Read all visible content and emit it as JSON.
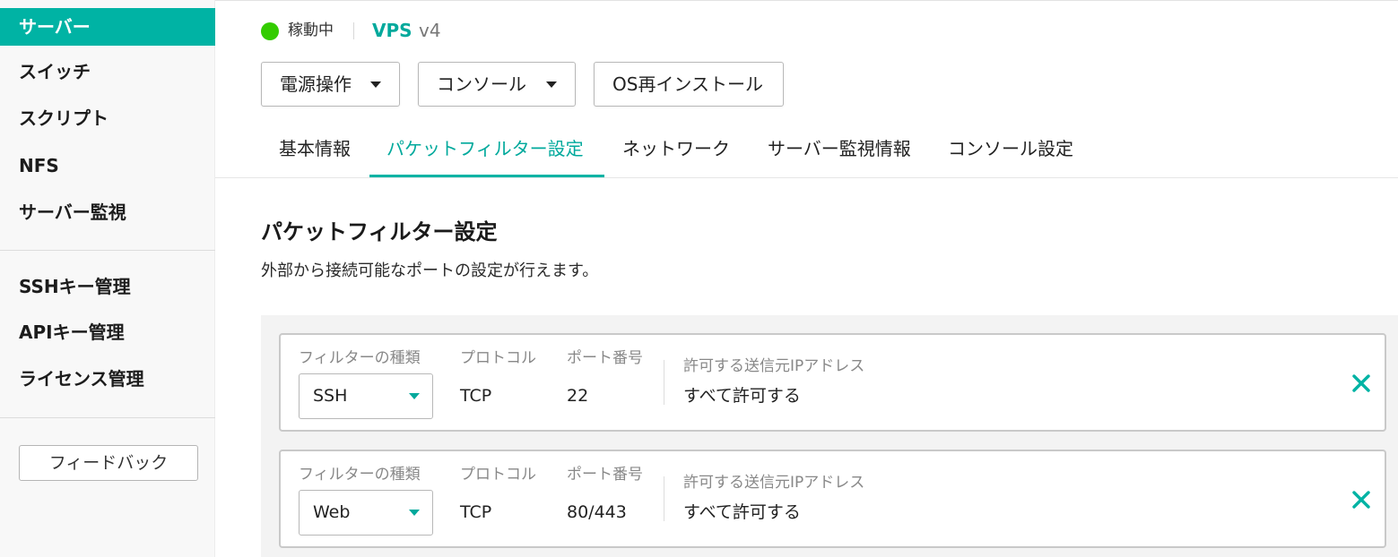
{
  "sidebar": {
    "items": [
      {
        "label": "サーバー",
        "active": true
      },
      {
        "label": "スイッチ"
      },
      {
        "label": "スクリプト"
      },
      {
        "label": "NFS"
      },
      {
        "label": "サーバー監視"
      },
      {
        "label": "SSHキー管理"
      },
      {
        "label": "APIキー管理"
      },
      {
        "label": "ライセンス管理"
      }
    ],
    "feedback_label": "フィードバック"
  },
  "header": {
    "status_text": "稼動中",
    "status_color": "#33cc00",
    "server_name": "VPS",
    "server_version": "v4",
    "actions": {
      "power_label": "電源操作",
      "console_label": "コンソール",
      "reinstall_label": "OS再インストール"
    }
  },
  "tabs": [
    {
      "label": "基本情報"
    },
    {
      "label": "パケットフィルター設定",
      "active": true
    },
    {
      "label": "ネットワーク"
    },
    {
      "label": "サーバー監視情報"
    },
    {
      "label": "コンソール設定"
    }
  ],
  "section": {
    "title": "パケットフィルター設定",
    "description": "外部から接続可能なポートの設定が行えます。"
  },
  "filter_labels": {
    "type": "フィルターの種類",
    "protocol": "プロトコル",
    "port": "ポート番号",
    "source_ip": "許可する送信元IPアドレス"
  },
  "filters": [
    {
      "type": "SSH",
      "protocol": "TCP",
      "port": "22",
      "source_ip": "すべて許可する"
    },
    {
      "type": "Web",
      "protocol": "TCP",
      "port": "80/443",
      "source_ip": "すべて許可する"
    }
  ],
  "colors": {
    "accent": "#00b3a4",
    "accent_text": "#00a99c",
    "sidebar_bg": "#f8f8f8"
  },
  "icons": {
    "delete": "close-icon",
    "dropdown": "caret-down-icon"
  }
}
